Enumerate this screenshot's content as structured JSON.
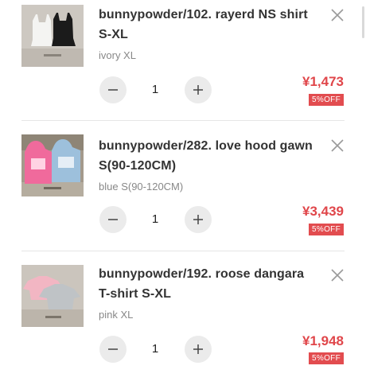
{
  "cart": {
    "items": [
      {
        "title": "bunnypowder/102. rayerd NS shirt S-XL",
        "variant": "ivory XL",
        "quantity": "1",
        "price": "¥1,473",
        "discount": "5%OFF",
        "image_icon": "product-photo-sleeveless-tops",
        "remove_icon": "close-icon"
      },
      {
        "title": "bunnypowder/282. love hood gawn S(90-120CM)",
        "variant": "blue S(90-120CM)",
        "quantity": "1",
        "price": "¥3,439",
        "discount": "5%OFF",
        "image_icon": "product-photo-hooded-gowns",
        "remove_icon": "close-icon"
      },
      {
        "title": "bunnypowder/192. roose dangara T-shirt S-XL",
        "variant": "pink XL",
        "quantity": "1",
        "price": "¥1,948",
        "discount": "5%OFF",
        "image_icon": "product-photo-tshirts",
        "remove_icon": "close-icon"
      }
    ]
  },
  "colors": {
    "price": "#e0464a",
    "badge": "#e24c4f",
    "stepper": "#ebebeb",
    "divider": "#e6e6e6"
  }
}
